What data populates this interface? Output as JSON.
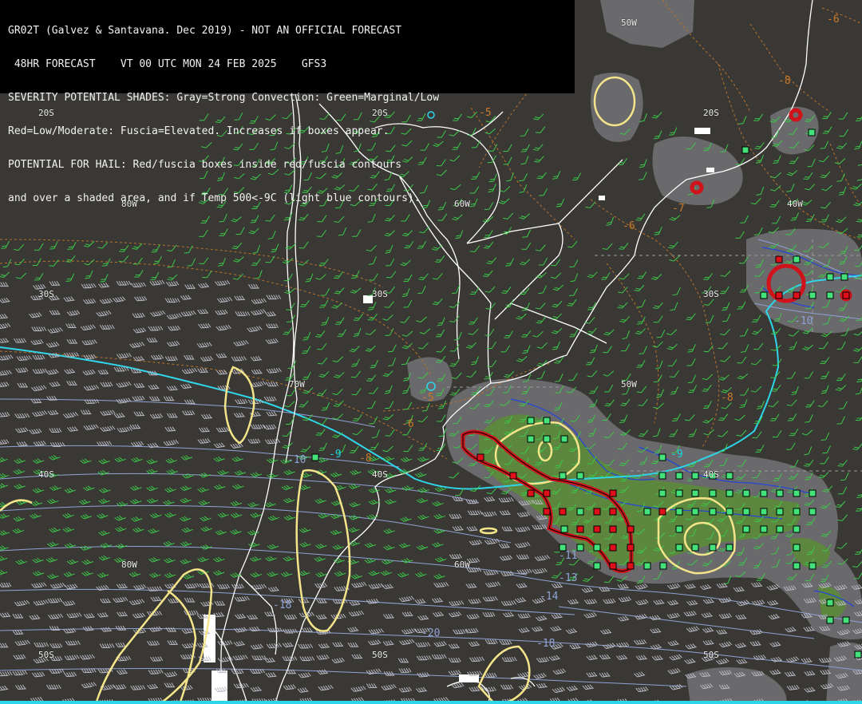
{
  "header": {
    "lines": [
      "GR02T (Galvez & Santavana. Dec 2019) - NOT AN OFFICIAL FORECAST",
      " 48HR FORECAST    VT 00 UTC MON 24 FEB 2025    GFS3",
      "SEVERITY POTENTIAL SHADES: Gray=Strong Convection: Green=Marginal/Low",
      "Red=Low/Moderate: Fuscia=Elevated. Increases if boxes appear.",
      "POTENTIAL FOR HAIL: Red/fuscia boxes inside red/fuscia contours",
      "and over a shaded area, and if Temp 500<-9C (light blue contours)."
    ]
  },
  "grid_labels": {
    "lat_20s_west": "20S",
    "lat_20s_mid": "20S",
    "lat_20s_east": "20S",
    "lon_50w_top": "50W",
    "lon_80w_upper": "80W",
    "lon_60w_upper": "60W",
    "lon_40w_upper": "40W",
    "lat_30s_west": "30S",
    "lat_30s_mid": "30S",
    "lat_30s_east": "30S",
    "lon_70w_mid": "70W",
    "lon_50w_mid": "50W",
    "lat_40s_west": "40S",
    "lat_40s_mid": "40S",
    "lat_40s_east": "40S",
    "lon_80w_lower": "80W",
    "lon_60w_lower": "60W",
    "lat_50s_west": "50S",
    "lat_50s_mid": "50S",
    "lat_50s_east": "50S"
  },
  "temp_labels": {
    "m6_top_right": "-6",
    "m8_top_right": "-8",
    "m5_north": "-5",
    "m7_brazil": "-7",
    "m6_brazil": "-6",
    "m10_east": "-10",
    "m8_east": "-8",
    "m5_center": "-5",
    "m6_center": "-6",
    "m8_center": "-8",
    "m9_center": "-9",
    "m9_east": "-9",
    "m10_west": "-10",
    "m13": "-13",
    "m14": "-14",
    "m18_left": "-18",
    "m20": "-20",
    "m18_bottom": "-18",
    "m11": "-11"
  },
  "colors": {
    "background": "#3a3834",
    "coastline": "#ffffff",
    "gray_shade": "#6d6c70",
    "green_shade": "#5c8a3a",
    "red_contour": "#d0121a",
    "yellow_contour": "#f4e58a",
    "cyan_contour": "#2fd6ea",
    "blue_contour": "#2446d8",
    "orange_contour": "#b8722a",
    "wind_barb_green": "#3cc94a",
    "wind_barb_gray": "#b9b9c4",
    "box_green": "#43e27a",
    "box_red": "#e0101a"
  }
}
